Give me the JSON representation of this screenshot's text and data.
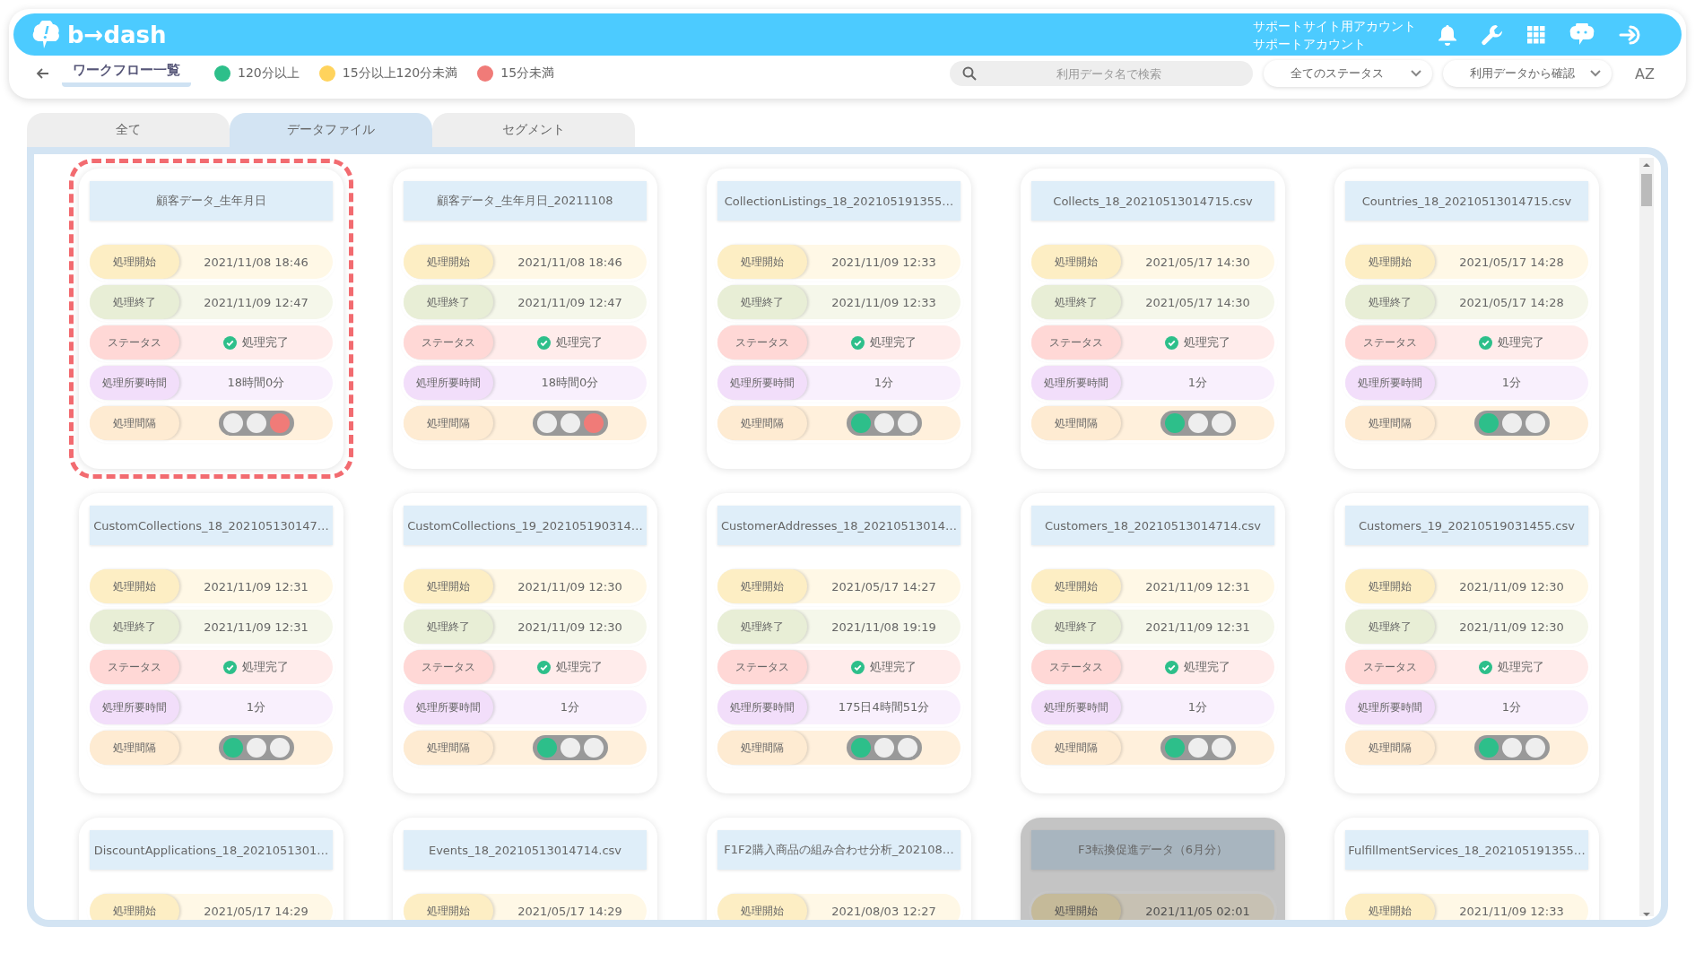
{
  "header": {
    "logo": "b→dash",
    "account": [
      "サポートサイト用アカウント",
      "サポートアカウント"
    ]
  },
  "toolbar": {
    "title": "ワークフロー一覧",
    "legend": [
      {
        "label": "120分以上",
        "color": "#2dbf8a"
      },
      {
        "label": "15分以上120分未満",
        "color": "#ffd35c"
      },
      {
        "label": "15分未満",
        "color": "#f07b78"
      }
    ],
    "search": {
      "placeholder": "利用データ名で検索"
    },
    "status_filter": "全てのステータス",
    "data_filter": "利用データから確認",
    "sort_label": "AZ"
  },
  "tabs": [
    {
      "label": "全て",
      "selected": false
    },
    {
      "label": "データファイル",
      "selected": true
    },
    {
      "label": "セグメント",
      "selected": false
    }
  ],
  "cards": [
    {
      "title": "顧客データ_生年月日",
      "highlighted": true,
      "disabled": false,
      "rows": [
        {
          "kind": "start",
          "label": "処理開始",
          "value": "2021/11/08 18:46"
        },
        {
          "kind": "end",
          "label": "処理終了",
          "value": "2021/11/09 12:47"
        },
        {
          "kind": "status",
          "label": "ステータス",
          "value": "処理完了"
        },
        {
          "kind": "duration",
          "label": "処理所要時間",
          "value": "18時間0分"
        },
        {
          "kind": "interval",
          "label": "処理間隔",
          "lights": [
            {
              "on": false
            },
            {
              "on": false
            },
            {
              "on": true
            }
          ]
        }
      ]
    },
    {
      "title": "顧客データ_生年月日_20211108",
      "highlighted": false,
      "disabled": false,
      "rows": [
        {
          "kind": "start",
          "label": "処理開始",
          "value": "2021/11/08 18:46"
        },
        {
          "kind": "end",
          "label": "処理終了",
          "value": "2021/11/09 12:47"
        },
        {
          "kind": "status",
          "label": "ステータス",
          "value": "処理完了"
        },
        {
          "kind": "duration",
          "label": "処理所要時間",
          "value": "18時間0分"
        },
        {
          "kind": "interval",
          "label": "処理間隔",
          "lights": [
            {
              "on": false
            },
            {
              "on": false
            },
            {
              "on": true
            }
          ]
        }
      ]
    },
    {
      "title": "CollectionListings_18_202105191355…",
      "highlighted": false,
      "disabled": false,
      "rows": [
        {
          "kind": "start",
          "label": "処理開始",
          "value": "2021/11/09 12:33"
        },
        {
          "kind": "end",
          "label": "処理終了",
          "value": "2021/11/09 12:33"
        },
        {
          "kind": "status",
          "label": "ステータス",
          "value": "処理完了"
        },
        {
          "kind": "duration",
          "label": "処理所要時間",
          "value": "1分"
        },
        {
          "kind": "interval",
          "label": "処理間隔",
          "lights": [
            {
              "on": true
            },
            {
              "on": false
            },
            {
              "on": false
            }
          ]
        }
      ]
    },
    {
      "title": "Collects_18_20210513014715.csv",
      "highlighted": false,
      "disabled": false,
      "rows": [
        {
          "kind": "start",
          "label": "処理開始",
          "value": "2021/05/17 14:30"
        },
        {
          "kind": "end",
          "label": "処理終了",
          "value": "2021/05/17 14:30"
        },
        {
          "kind": "status",
          "label": "ステータス",
          "value": "処理完了"
        },
        {
          "kind": "duration",
          "label": "処理所要時間",
          "value": "1分"
        },
        {
          "kind": "interval",
          "label": "処理間隔",
          "lights": [
            {
              "on": true
            },
            {
              "on": false
            },
            {
              "on": false
            }
          ]
        }
      ]
    },
    {
      "title": "Countries_18_20210513014715.csv",
      "highlighted": false,
      "disabled": false,
      "rows": [
        {
          "kind": "start",
          "label": "処理開始",
          "value": "2021/05/17 14:28"
        },
        {
          "kind": "end",
          "label": "処理終了",
          "value": "2021/05/17 14:28"
        },
        {
          "kind": "status",
          "label": "ステータス",
          "value": "処理完了"
        },
        {
          "kind": "duration",
          "label": "処理所要時間",
          "value": "1分"
        },
        {
          "kind": "interval",
          "label": "処理間隔",
          "lights": [
            {
              "on": true
            },
            {
              "on": false
            },
            {
              "on": false
            }
          ]
        }
      ]
    },
    {
      "title": "CustomCollections_18_202105130147…",
      "highlighted": false,
      "disabled": false,
      "rows": [
        {
          "kind": "start",
          "label": "処理開始",
          "value": "2021/11/09 12:31"
        },
        {
          "kind": "end",
          "label": "処理終了",
          "value": "2021/11/09 12:31"
        },
        {
          "kind": "status",
          "label": "ステータス",
          "value": "処理完了"
        },
        {
          "kind": "duration",
          "label": "処理所要時間",
          "value": "1分"
        },
        {
          "kind": "interval",
          "label": "処理間隔",
          "lights": [
            {
              "on": true
            },
            {
              "on": false
            },
            {
              "on": false
            }
          ]
        }
      ]
    },
    {
      "title": "CustomCollections_19_202105190314…",
      "highlighted": false,
      "disabled": false,
      "rows": [
        {
          "kind": "start",
          "label": "処理開始",
          "value": "2021/11/09 12:30"
        },
        {
          "kind": "end",
          "label": "処理終了",
          "value": "2021/11/09 12:30"
        },
        {
          "kind": "status",
          "label": "ステータス",
          "value": "処理完了"
        },
        {
          "kind": "duration",
          "label": "処理所要時間",
          "value": "1分"
        },
        {
          "kind": "interval",
          "label": "処理間隔",
          "lights": [
            {
              "on": true
            },
            {
              "on": false
            },
            {
              "on": false
            }
          ]
        }
      ]
    },
    {
      "title": "CustomerAddresses_18_20210513014…",
      "highlighted": false,
      "disabled": false,
      "rows": [
        {
          "kind": "start",
          "label": "処理開始",
          "value": "2021/05/17 14:27"
        },
        {
          "kind": "end",
          "label": "処理終了",
          "value": "2021/11/08 19:19"
        },
        {
          "kind": "status",
          "label": "ステータス",
          "value": "処理完了"
        },
        {
          "kind": "duration",
          "label": "処理所要時間",
          "value": "175日4時間51分"
        },
        {
          "kind": "interval",
          "label": "処理間隔",
          "lights": [
            {
              "on": true
            },
            {
              "on": false
            },
            {
              "on": false
            }
          ]
        }
      ]
    },
    {
      "title": "Customers_18_20210513014714.csv",
      "highlighted": false,
      "disabled": false,
      "rows": [
        {
          "kind": "start",
          "label": "処理開始",
          "value": "2021/11/09 12:31"
        },
        {
          "kind": "end",
          "label": "処理終了",
          "value": "2021/11/09 12:31"
        },
        {
          "kind": "status",
          "label": "ステータス",
          "value": "処理完了"
        },
        {
          "kind": "duration",
          "label": "処理所要時間",
          "value": "1分"
        },
        {
          "kind": "interval",
          "label": "処理間隔",
          "lights": [
            {
              "on": true
            },
            {
              "on": false
            },
            {
              "on": false
            }
          ]
        }
      ]
    },
    {
      "title": "Customers_19_20210519031455.csv",
      "highlighted": false,
      "disabled": false,
      "rows": [
        {
          "kind": "start",
          "label": "処理開始",
          "value": "2021/11/09 12:30"
        },
        {
          "kind": "end",
          "label": "処理終了",
          "value": "2021/11/09 12:30"
        },
        {
          "kind": "status",
          "label": "ステータス",
          "value": "処理完了"
        },
        {
          "kind": "duration",
          "label": "処理所要時間",
          "value": "1分"
        },
        {
          "kind": "interval",
          "label": "処理間隔",
          "lights": [
            {
              "on": true
            },
            {
              "on": false
            },
            {
              "on": false
            }
          ]
        }
      ]
    },
    {
      "title": "DiscountApplications_18_2021051301…",
      "highlighted": false,
      "disabled": false,
      "rows": [
        {
          "kind": "start",
          "label": "処理開始",
          "value": "2021/05/17 14:29"
        }
      ]
    },
    {
      "title": "Events_18_20210513014714.csv",
      "highlighted": false,
      "disabled": false,
      "rows": [
        {
          "kind": "start",
          "label": "処理開始",
          "value": "2021/05/17 14:29"
        }
      ]
    },
    {
      "title": "F1F2購入商品の組み合わせ分析_202108…",
      "highlighted": false,
      "disabled": false,
      "rows": [
        {
          "kind": "start",
          "label": "処理開始",
          "value": "2021/08/03 12:27"
        }
      ]
    },
    {
      "title": "F3転換促進データ（6月分）",
      "highlighted": false,
      "disabled": true,
      "rows": [
        {
          "kind": "start",
          "label": "処理開始",
          "value": "2021/11/05 02:01"
        }
      ]
    },
    {
      "title": "FulfillmentServices_18_202105191355…",
      "highlighted": false,
      "disabled": false,
      "rows": [
        {
          "kind": "start",
          "label": "処理開始",
          "value": "2021/11/09 12:33"
        }
      ]
    }
  ]
}
